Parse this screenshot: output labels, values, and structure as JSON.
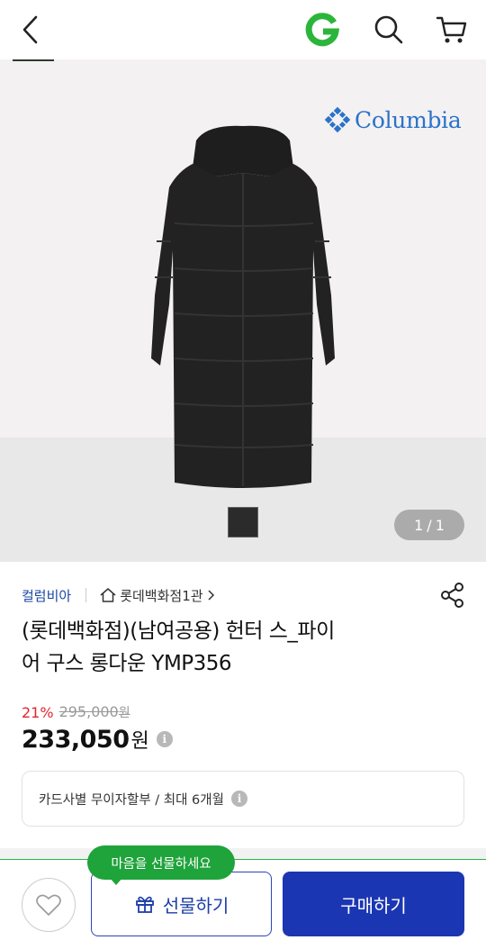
{
  "header": {
    "back_icon": "chevron-left-icon",
    "gmarket_icon": "g-logo-icon",
    "search_icon": "search-icon",
    "cart_icon": "cart-icon"
  },
  "gallery": {
    "brand_logo_text": "Columbia",
    "counter_current": "1",
    "counter_sep": "/",
    "counter_total": "1"
  },
  "product": {
    "brand": "컬럼비아",
    "store": "롯데백화점1관",
    "title_line1": "(롯데백화점)(남여공용) 헌터 스_파이",
    "title_line2": "어 구스 롱다운 YMP356",
    "discount_rate": "21%",
    "original_price": "295,000",
    "original_won": "원",
    "price": "233,050",
    "price_won": "원",
    "installment": "카드사별 무이자할부 / 최대 6개월"
  },
  "bottom_bar": {
    "tooltip": "마음을 선물하세요",
    "gift_label": "선물하기",
    "buy_label": "구매하기"
  },
  "colors": {
    "accent_blue": "#1b36b2",
    "gift_green": "#1fa33b",
    "discount_red": "#e0262e",
    "brand_blue": "#2a73c8"
  }
}
